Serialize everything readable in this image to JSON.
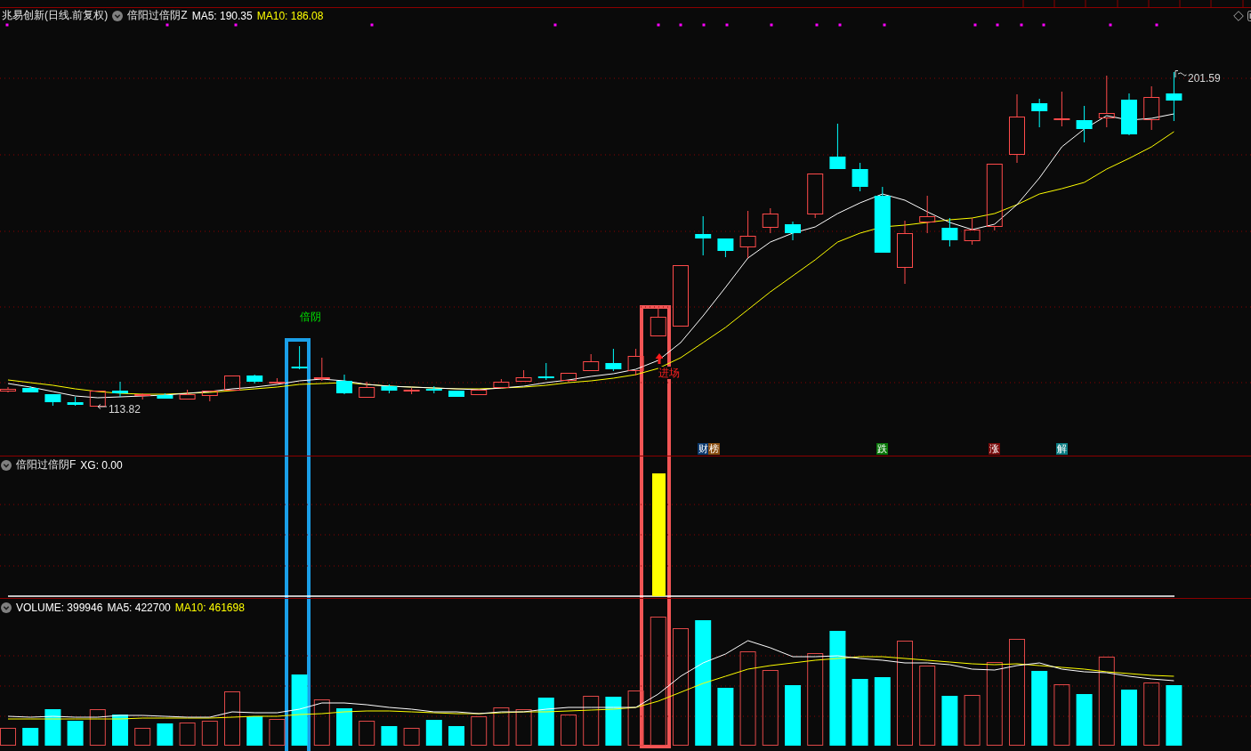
{
  "header": {
    "security": "兆易创新(日线.前复权)",
    "formula": "倍阳过倍阴Z",
    "readings": [
      {
        "text": "MA5: 190.35",
        "color": "#ffffff"
      },
      {
        "text": "MA10: 186.08",
        "color": "#ffff00"
      }
    ]
  },
  "price_chart": {
    "high_label": "201.59",
    "low_label": "113.82",
    "signal_label": "倍阴",
    "entry_label": "进场",
    "event_badges": [
      {
        "text": "财",
        "color": "#0c3a6e"
      },
      {
        "text": "榜",
        "color": "#8a4e10"
      },
      {
        "text": "跌",
        "color": "#0a780a"
      },
      {
        "text": "涨",
        "color": "#780a0a"
      },
      {
        "text": "解",
        "color": "#0a7c82"
      }
    ]
  },
  "indicator_panel": {
    "title": "倍阳过倍阴F",
    "readings": [
      {
        "text": "XG: 0.00",
        "color": "#ffffff"
      }
    ]
  },
  "volume_panel": {
    "readings": [
      {
        "text": "VOLUME: 399946",
        "color": "#ffffff"
      },
      {
        "text": "MA5: 422700",
        "color": "#ffffff"
      },
      {
        "text": "MA10: 461698",
        "color": "#ffff00"
      }
    ]
  }
}
